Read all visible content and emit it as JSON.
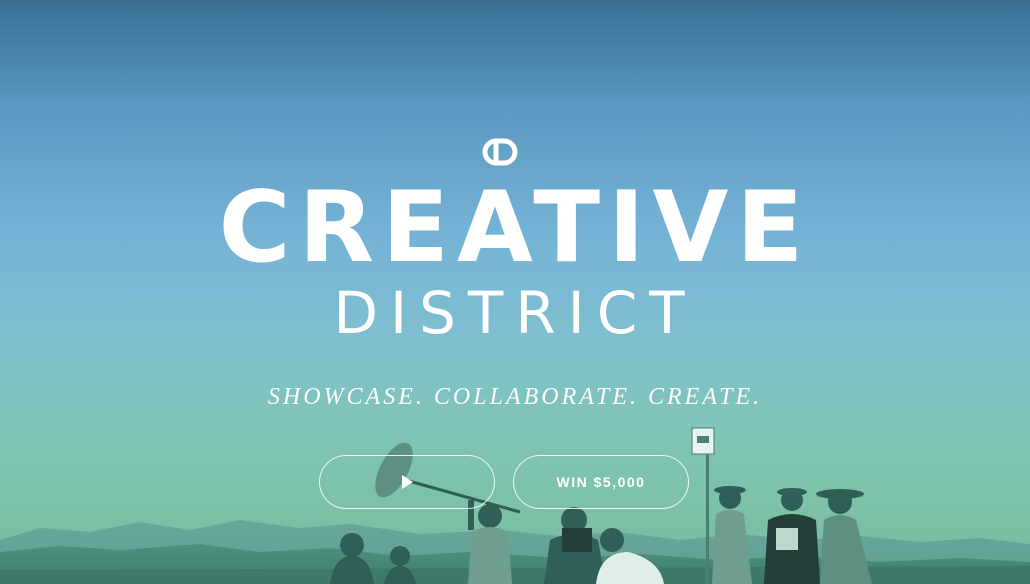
{
  "brand": {
    "logo_icon": "cd-monogram-icon",
    "title_line1": "CREATIVE",
    "title_line2": "DISTRICT",
    "tagline": "SHOWCASE. COLLABORATE. CREATE."
  },
  "buttons": {
    "play_icon": "play-icon",
    "win_label": "WIN $5,000"
  },
  "colors": {
    "sky_top": "#3a6f93",
    "sky_mid": "#75b3d6",
    "horizon": "#7cc1a8",
    "text": "#ffffff"
  }
}
